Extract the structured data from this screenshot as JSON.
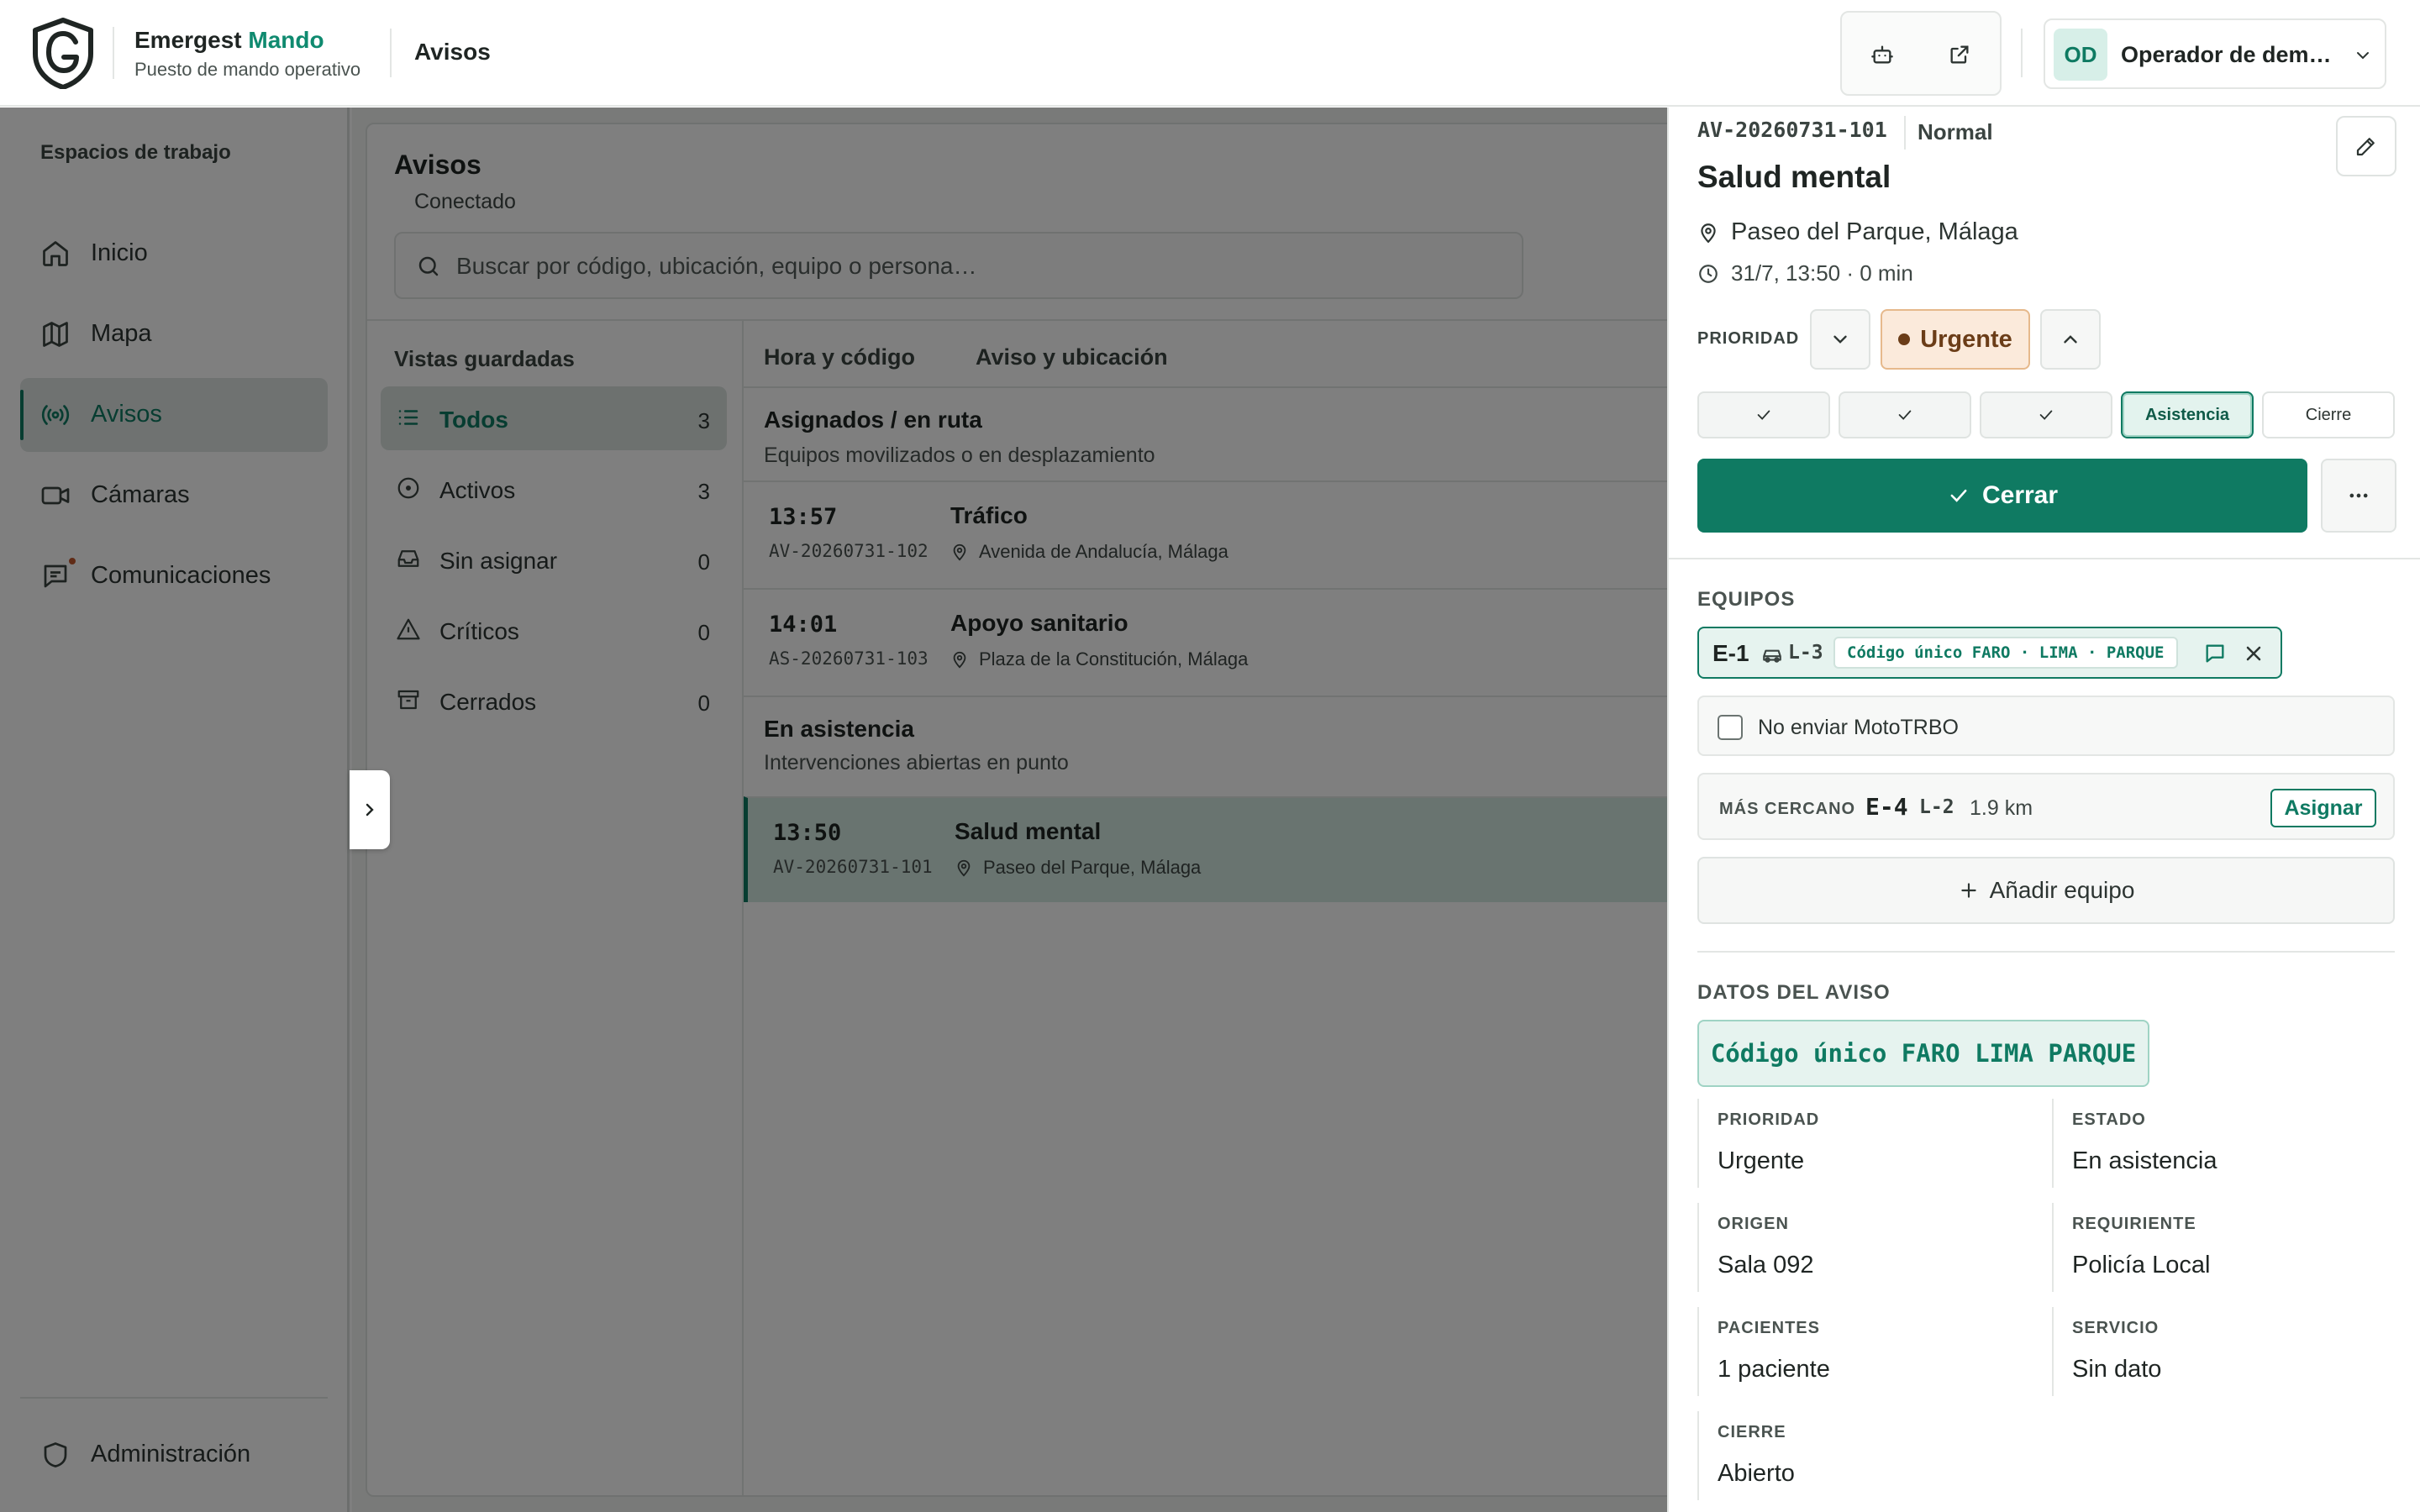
{
  "header": {
    "brand_name": "Emergest",
    "brand_accent": "Mando",
    "brand_subtitle": "Puesto de mando operativo",
    "page_title": "Avisos",
    "user_initials": "OD",
    "user_name": "Operador de dem…"
  },
  "sidebar": {
    "section_title": "Espacios de trabajo",
    "items": [
      {
        "label": "Inicio",
        "icon": "home-icon"
      },
      {
        "label": "Mapa",
        "icon": "map-icon"
      },
      {
        "label": "Avisos",
        "icon": "broadcast-icon",
        "active": true
      },
      {
        "label": "Cámaras",
        "icon": "video-camera-icon"
      },
      {
        "label": "Comunicaciones",
        "icon": "message-icon",
        "has_notification": true
      }
    ],
    "bottom_item": {
      "label": "Administración",
      "icon": "shield-icon"
    }
  },
  "list_panel": {
    "title": "Avisos",
    "status": "Conectado",
    "search_placeholder": "Buscar por código, ubicación, equipo o persona…",
    "saved_views_title": "Vistas guardadas",
    "views": [
      {
        "label": "Todos",
        "count": "3",
        "icon": "list-icon",
        "active": true
      },
      {
        "label": "Activos",
        "count": "3",
        "icon": "circle-dot-icon"
      },
      {
        "label": "Sin asignar",
        "count": "0",
        "icon": "inbox-icon"
      },
      {
        "label": "Críticos",
        "count": "0",
        "icon": "warning-icon"
      },
      {
        "label": "Cerrados",
        "count": "0",
        "icon": "archive-icon"
      }
    ],
    "columns": [
      "Hora y código",
      "Aviso y ubicación"
    ],
    "groups": [
      {
        "title": "Asignados / en ruta",
        "subtitle": "Equipos movilizados o en desplazamiento",
        "rows": [
          {
            "time": "13:57",
            "code": "AV-20260731-102",
            "title": "Tráfico",
            "location": "Avenida de Andalucía, Málaga"
          },
          {
            "time": "14:01",
            "code": "AS-20260731-103",
            "title": "Apoyo sanitario",
            "location": "Plaza de la Constitución, Málaga"
          }
        ]
      },
      {
        "title": "En asistencia",
        "subtitle": "Intervenciones abiertas en punto",
        "rows": [
          {
            "time": "13:50",
            "code": "AV-20260731-101",
            "title": "Salud mental",
            "location": "Paseo del Parque, Málaga",
            "selected": true
          }
        ]
      }
    ]
  },
  "detail": {
    "code": "AV-20260731-101",
    "priority_tag": "Normal",
    "title": "Salud mental",
    "location": "Paseo del Parque, Málaga",
    "time": "31/7, 13:50 · 0 min",
    "priority_label": "PRIORIDAD",
    "priority_value": "Urgente",
    "steps": [
      "",
      "",
      "",
      "Asistencia",
      "Cierre"
    ],
    "primary_action": "Cerrar",
    "teams_label": "EQUIPOS",
    "team": {
      "unit": "E-1",
      "vehicle": "L-3",
      "code": "Código único FARO · LIMA · PARQUE"
    },
    "checkbox_label": "No enviar MotoTRBO",
    "nearest": {
      "label": "MÁS CERCANO",
      "unit": "E-4",
      "vehicle": "L-2",
      "distance": "1.9 km",
      "action": "Asignar"
    },
    "add_team": "Añadir equipo",
    "data_label": "DATOS DEL AVISO",
    "unique_code": "Código único FARO LIMA PARQUE",
    "fields": [
      {
        "key": "PRIORIDAD",
        "value": "Urgente"
      },
      {
        "key": "ESTADO",
        "value": "En asistencia"
      },
      {
        "key": "ORIGEN",
        "value": "Sala 092"
      },
      {
        "key": "REQUIRIENTE",
        "value": "Policía Local"
      },
      {
        "key": "PACIENTES",
        "value": "1 paciente"
      },
      {
        "key": "SERVICIO",
        "value": "Sin dato"
      },
      {
        "key": "CIERRE",
        "value": "Abierto"
      }
    ]
  },
  "colors": {
    "accent": "#0f7a62",
    "urgent_bg": "#fbeadb",
    "overlay": "rgba(0,0,0,0.5)"
  }
}
